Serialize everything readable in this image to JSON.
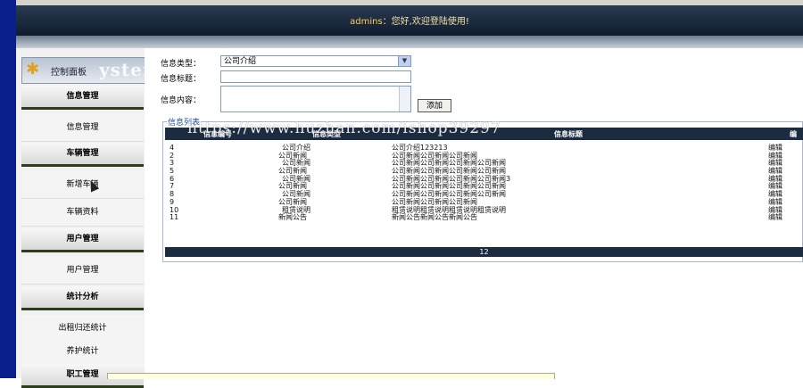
{
  "header": {
    "username": "admins",
    "greeting": "：您好,欢迎登陆使用!"
  },
  "logo": {
    "label": "控制面板",
    "watermark": "ystem"
  },
  "sidebar": {
    "sections": [
      {
        "heading": "信息管理",
        "items": [
          "信息管理"
        ]
      },
      {
        "heading": "车辆管理",
        "items": [
          "新增车辆",
          "车辆资料"
        ]
      },
      {
        "heading": "用户管理",
        "items": [
          "用户管理"
        ]
      },
      {
        "heading": "统计分析",
        "items": [
          "出租归还统计",
          "养护统计"
        ]
      },
      {
        "heading": "职工管理",
        "items": []
      }
    ]
  },
  "form": {
    "type_label": "信息类型：",
    "type_value": "公司介绍",
    "title_label": "信息标题：",
    "content_label": "信息内容：",
    "add_button": "添加"
  },
  "list": {
    "legend": "信息列表",
    "watermark": "https://www.huzhan.com/ishop39297",
    "columns": [
      "信息编号",
      "信息类型",
      "信息标题",
      "编"
    ],
    "rows": [
      {
        "id": "4",
        "type": "公司介绍",
        "title": "公司介绍123213",
        "action": "编辑"
      },
      {
        "id": "2",
        "type": "公司新闻",
        "title": "公司新闻公司新闻公司新闻",
        "action": "编辑"
      },
      {
        "id": "3",
        "type": "公司新闻",
        "title": "公司新闻公司新闻公司新闻公司新闻",
        "action": "编辑"
      },
      {
        "id": "5",
        "type": "公司新闻",
        "title": "公司新闻公司新闻公司新闻公司新闻",
        "action": "编辑"
      },
      {
        "id": "6",
        "type": "公司新闻",
        "title": "公司新闻公司新闻公司新闻公司新闻3",
        "action": "编辑"
      },
      {
        "id": "7",
        "type": "公司新闻",
        "title": "公司新闻公司新闻公司新闻公司新闻",
        "action": "编辑"
      },
      {
        "id": "8",
        "type": "公司新闻",
        "title": "公司新闻公司新闻公司新闻公司新闻",
        "action": "编辑"
      },
      {
        "id": "9",
        "type": "公司新闻",
        "title": "公司新闻公司新闻公司新闻",
        "action": "编辑"
      },
      {
        "id": "10",
        "type": "租赁说明",
        "title": "租赁说明租赁说明租赁说明租赁说明",
        "action": "编辑"
      },
      {
        "id": "11",
        "type": "新闻公告",
        "title": "新闻公告新闻公告新闻公告",
        "action": "编辑"
      }
    ],
    "footer": "12"
  },
  "colors": {
    "header_bg": "#0e1c2e",
    "table_head_bg": "#1c2c40",
    "left_edge": "#0a1e8c"
  }
}
